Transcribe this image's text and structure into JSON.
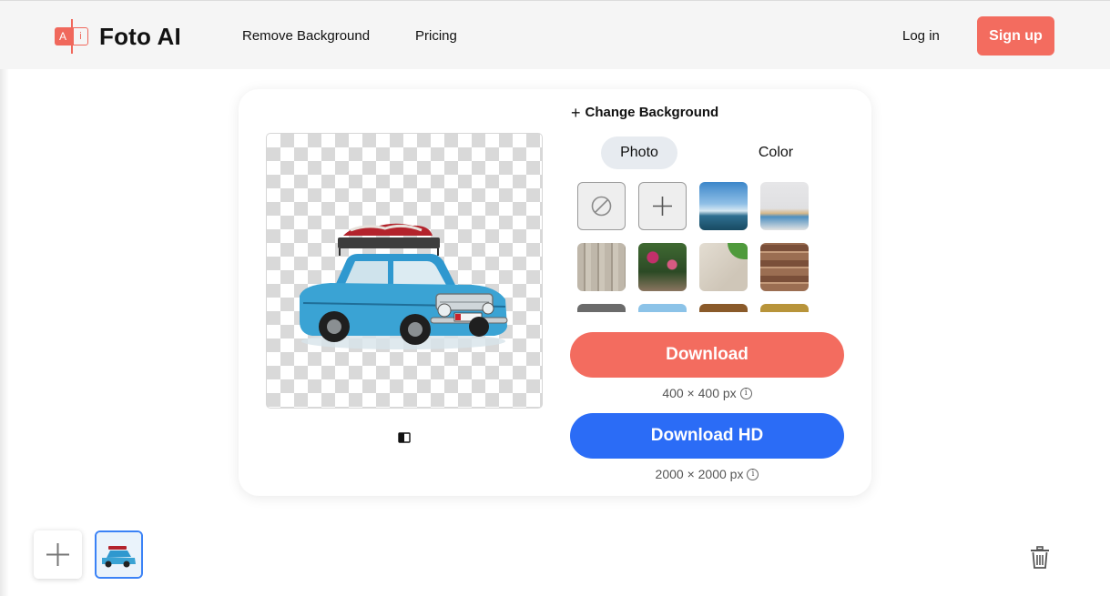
{
  "header": {
    "logo_letter_a": "A",
    "logo_letter_i": "i",
    "brand": "Foto AI",
    "nav": [
      {
        "label": "Remove Background"
      },
      {
        "label": "Pricing"
      }
    ],
    "login_label": "Log in",
    "signup_label": "Sign up"
  },
  "editor": {
    "change_background_label": "Change Background",
    "tabs": [
      {
        "label": "Photo",
        "selected": true
      },
      {
        "label": "Color",
        "selected": false
      }
    ],
    "background_tiles": [
      {
        "icon": "no-background-icon"
      },
      {
        "icon": "add-icon"
      },
      {
        "icon": "sea-photo"
      },
      {
        "icon": "color-pencils-photo"
      },
      {
        "icon": "wood-planks-photo"
      },
      {
        "icon": "flowers-photo"
      },
      {
        "icon": "plaster-leaf-photo"
      },
      {
        "icon": "bricks-photo"
      },
      {
        "icon": "stone-photo"
      },
      {
        "icon": "sky-photo"
      },
      {
        "icon": "wood-photo"
      },
      {
        "icon": "texture-photo"
      }
    ],
    "download_label": "Download",
    "download_size": "400 × 400 px",
    "download_hd_label": "Download HD",
    "download_hd_size": "2000 × 2000 px",
    "info_glyph": "i"
  },
  "colors": {
    "accent_coral": "#f36c5f",
    "accent_blue": "#2b6cf6",
    "car_blue": "#3aa3d4"
  }
}
